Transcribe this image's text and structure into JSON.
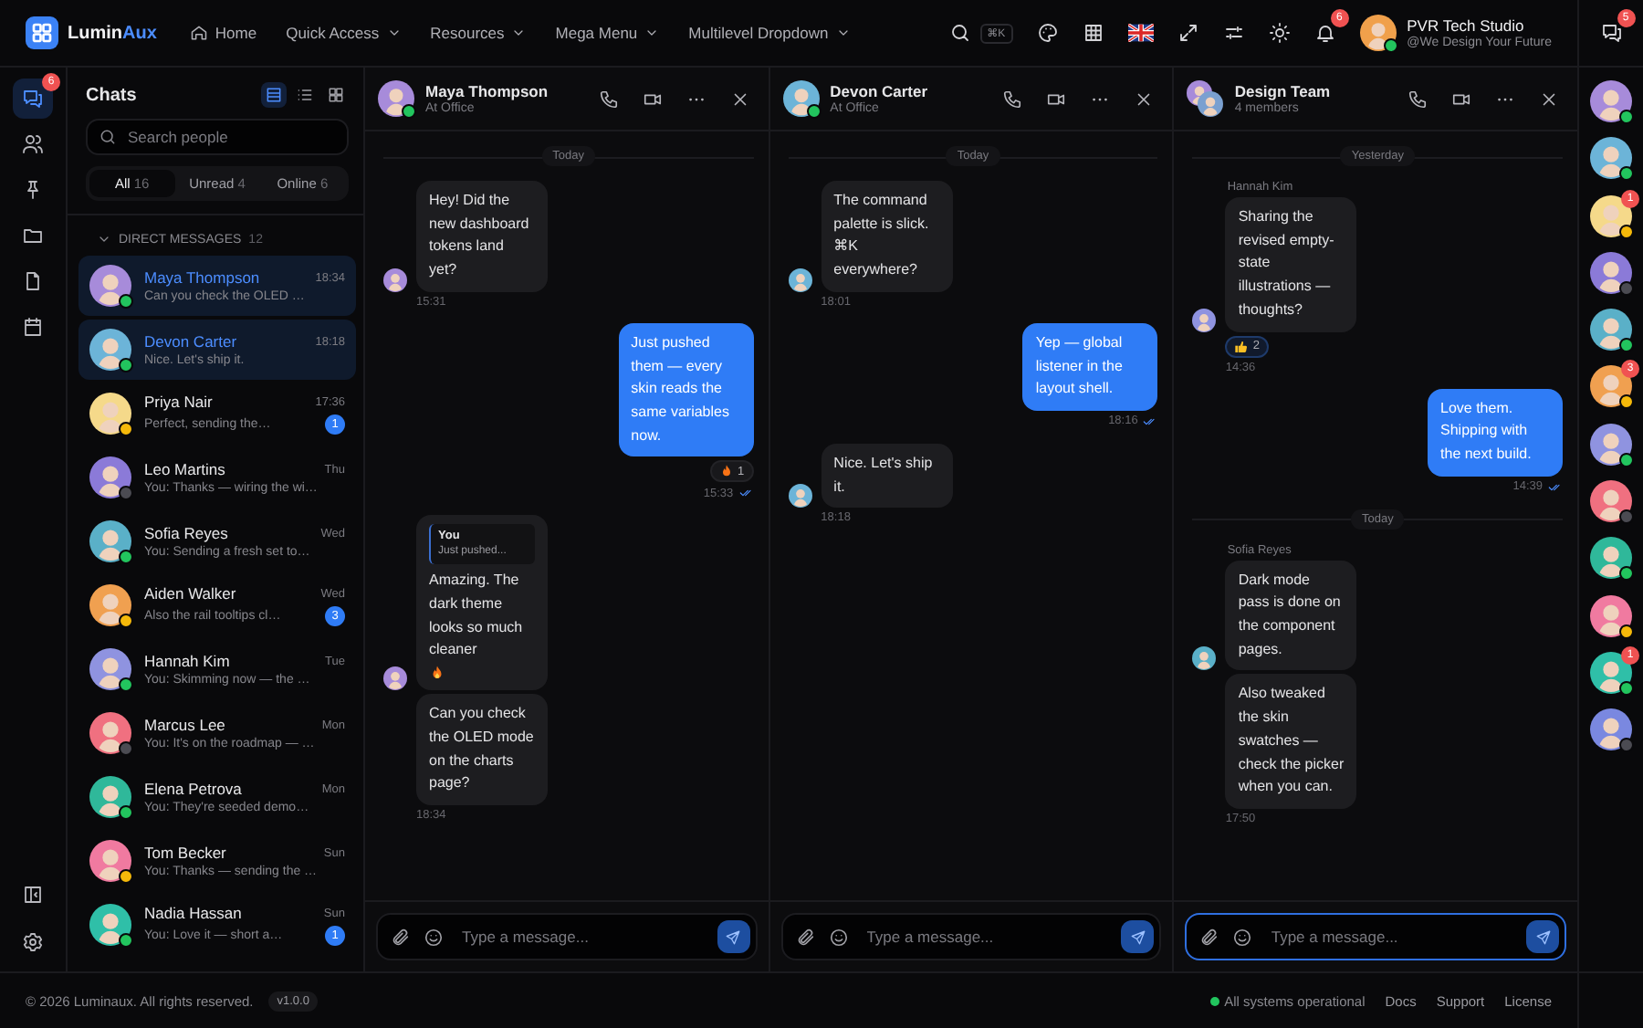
{
  "brand": {
    "name": "Lumin",
    "accent": "Aux"
  },
  "nav": [
    {
      "label": "Home",
      "kind": "home"
    },
    {
      "label": "Quick Access",
      "kind": "dropdown"
    },
    {
      "label": "Resources",
      "kind": "dropdown"
    },
    {
      "label": "Mega Menu",
      "kind": "dropdown"
    },
    {
      "label": "Multilevel Dropdown",
      "kind": "dropdown"
    }
  ],
  "shortcut": "⌘K",
  "notifications": {
    "badge": "6"
  },
  "user": {
    "name": "PVR Tech Studio",
    "tagline": "@We Design Your Future",
    "color": "#22c55e"
  },
  "messages_badge": "5",
  "rail": [
    {
      "kind": "chat",
      "selected": true,
      "badge": "6"
    },
    {
      "kind": "users",
      "selected": false
    },
    {
      "kind": "pin",
      "selected": false
    },
    {
      "kind": "folder",
      "selected": false
    },
    {
      "kind": "file",
      "selected": false
    },
    {
      "kind": "calendar",
      "selected": false
    }
  ],
  "chat_list": {
    "title": "Chats",
    "views": [
      {
        "kind": "rows",
        "selected": true
      },
      {
        "kind": "list",
        "selected": false
      },
      {
        "kind": "grid",
        "selected": false
      }
    ],
    "search": {
      "placeholder": "Search people"
    },
    "filters": [
      {
        "label": "All",
        "count": "16",
        "selected": true
      },
      {
        "label": "Unread",
        "count": "4",
        "selected": false
      },
      {
        "label": "Online",
        "count": "6",
        "selected": false
      }
    ],
    "section": {
      "label": "DIRECT MESSAGES",
      "count": "12",
      "expanded": true
    },
    "contacts": [
      {
        "name": "Maya Thompson",
        "preview": "Can you check the OLED …",
        "time": "18:34",
        "color": "#22c55e",
        "selected": true
      },
      {
        "name": "Devon Carter",
        "preview": "Nice. Let's ship it.",
        "time": "18:18",
        "color": "#22c55e",
        "selected": true
      },
      {
        "name": "Priya Nair",
        "preview": "Perfect, sending the…",
        "time": "17:36",
        "color": "#f5b90a",
        "selected": false,
        "unread": "1"
      },
      {
        "name": "Leo Martins",
        "preview": "You: Thanks — wiring the wi…",
        "time": "Thu",
        "color": "#4b4b52",
        "selected": false
      },
      {
        "name": "Sofia Reyes",
        "preview": "You: Sending a fresh set to…",
        "time": "Wed",
        "color": "#22c55e",
        "selected": false
      },
      {
        "name": "Aiden Walker",
        "preview": "Also the rail tooltips cl…",
        "time": "Wed",
        "color": "#f5b90a",
        "selected": false,
        "unread": "3"
      },
      {
        "name": "Hannah Kim",
        "preview": "You: Skimming now — the …",
        "time": "Tue",
        "color": "#22c55e",
        "selected": false
      },
      {
        "name": "Marcus Lee",
        "preview": "You: It's on the roadmap — …",
        "time": "Mon",
        "color": "#4b4b52",
        "selected": false
      },
      {
        "name": "Elena Petrova",
        "preview": "You: They're seeded demo…",
        "time": "Mon",
        "color": "#22c55e",
        "selected": false
      },
      {
        "name": "Tom Becker",
        "preview": "You: Thanks — sending the …",
        "time": "Sun",
        "color": "#f5b90a",
        "selected": false
      },
      {
        "name": "Nadia Hassan",
        "preview": "You: Love it — short a…",
        "time": "Sun",
        "color": "#22c55e",
        "selected": false,
        "unread": "1"
      }
    ]
  },
  "chats": [
    {
      "kind": "direct",
      "title": "Maya Thompson",
      "subtitle": "At Office",
      "color": "#22c55e",
      "messages": [
        {
          "kind": "date",
          "label": "Today"
        },
        {
          "kind": "in",
          "bubbles": [
            {
              "text": "Hey! Did the new dashboard tokens land yet?"
            }
          ],
          "time": "15:31"
        },
        {
          "kind": "out",
          "bubbles": [
            {
              "text": "Just pushed them — every skin reads the same variables now."
            }
          ],
          "reaction": {
            "kind": "fire",
            "count": "1"
          },
          "time": "15:33",
          "read": true
        },
        {
          "kind": "in",
          "bubbles": [
            {
              "quote": {
                "author": "You",
                "text": "Just pushed..."
              },
              "text": "Amazing. The dark theme looks so much cleaner",
              "kind": "with-flame"
            },
            {
              "kind": "plain",
              "text": "Can you check the OLED mode on the charts page?"
            }
          ],
          "time": "18:34"
        }
      ],
      "composer": {
        "placeholder": "Type a message...",
        "focused": false
      }
    },
    {
      "kind": "direct",
      "title": "Devon Carter",
      "subtitle": "At Office",
      "color": "#22c55e",
      "messages": [
        {
          "kind": "date",
          "label": "Today"
        },
        {
          "kind": "in",
          "bubbles": [
            {
              "text": "The command palette is slick. ⌘K everywhere?"
            }
          ],
          "time": "18:01"
        },
        {
          "kind": "out",
          "bubbles": [
            {
              "text": "Yep — global listener in the layout shell."
            }
          ],
          "time": "18:16",
          "read": true
        },
        {
          "kind": "in",
          "bubbles": [
            {
              "text": "Nice. Let's ship it."
            }
          ],
          "time": "18:18"
        }
      ],
      "composer": {
        "placeholder": "Type a message...",
        "focused": false
      }
    },
    {
      "kind": "group",
      "title": "Design Team",
      "subtitle": "4 members",
      "messages": [
        {
          "kind": "date",
          "label": "Yesterday"
        },
        {
          "kind": "in",
          "sender": "Hannah Kim",
          "bubbles": [
            {
              "text": "Sharing the revised empty-state illustrations — thoughts?"
            }
          ],
          "reaction": {
            "kind": "thumbs-up",
            "count": "2"
          },
          "time": "14:36"
        },
        {
          "kind": "out",
          "bubbles": [
            {
              "text": "Love them. Shipping with the next build."
            }
          ],
          "time": "14:39",
          "read": true
        },
        {
          "kind": "date",
          "label": "Today"
        },
        {
          "kind": "in",
          "sender": "Sofia Reyes",
          "bubbles": [
            {
              "text": "Dark mode pass is done on the component pages."
            },
            {
              "text": "Also tweaked the skin swatches — check the picker when you can."
            }
          ],
          "time": "17:50"
        }
      ],
      "composer": {
        "placeholder": "Type a message...",
        "focused": true
      }
    }
  ],
  "presence": [
    {
      "color": "#22c55e"
    },
    {
      "color": "#22c55e"
    },
    {
      "color": "#f5b90a",
      "badge": "1"
    },
    {
      "color": "#4b4b52"
    },
    {
      "color": "#22c55e"
    },
    {
      "color": "#f5b90a",
      "badge": "3"
    },
    {
      "color": "#22c55e"
    },
    {
      "color": "#4b4b52"
    },
    {
      "color": "#22c55e"
    },
    {
      "color": "#f5b90a"
    },
    {
      "color": "#22c55e",
      "badge": "1"
    },
    {
      "color": "#4b4b52"
    }
  ],
  "footer": {
    "copyright": "© 2026 Luminaux. All rights reserved.",
    "version": "v1.0.0",
    "system": {
      "text": "All systems operational",
      "ok": true
    },
    "links": [
      "Docs",
      "Support",
      "License"
    ]
  }
}
